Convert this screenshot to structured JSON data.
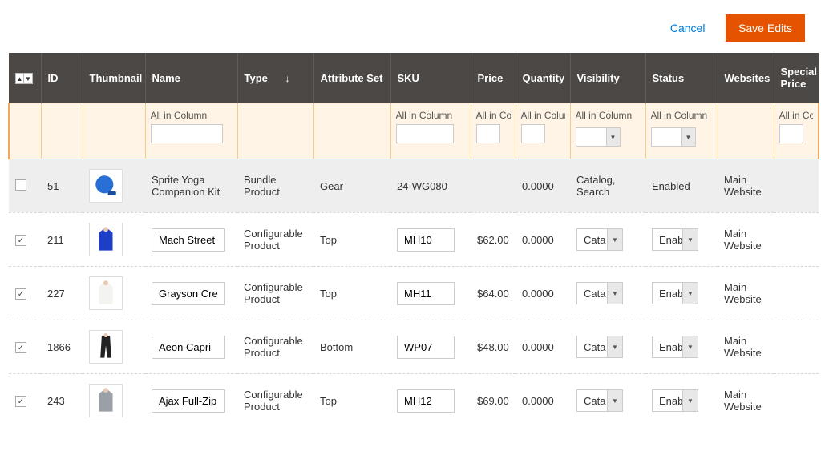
{
  "actions": {
    "cancel": "Cancel",
    "save": "Save Edits"
  },
  "headers": {
    "id": "ID",
    "thumbnail": "Thumbnail",
    "name": "Name",
    "type": "Type",
    "attribute_set": "Attribute Set",
    "sku": "SKU",
    "price": "Price",
    "quantity": "Quantity",
    "visibility": "Visibility",
    "status": "Status",
    "websites": "Websites",
    "special_price": "Special Price"
  },
  "filter": {
    "label": "All in Column"
  },
  "rows": [
    {
      "checked": false,
      "editable": false,
      "id": "51",
      "thumb_color": "#2a6fd6",
      "shape": "ball",
      "name": "Sprite Yoga Companion Kit",
      "type": "Bundle Product",
      "attribute_set": "Gear",
      "sku": "24-WG080",
      "price": "",
      "quantity": "0.0000",
      "visibility": "Catalog, Search",
      "status": "Enabled",
      "websites": "Main Website"
    },
    {
      "checked": true,
      "editable": true,
      "id": "211",
      "thumb_color": "#1f3ec7",
      "shape": "hoodie",
      "name": "Mach Street S",
      "type": "Configurable Product",
      "attribute_set": "Top",
      "sku": "MH10",
      "price": "$62.00",
      "quantity": "0.0000",
      "visibility": "Cata",
      "status": "Enab",
      "websites": "Main Website"
    },
    {
      "checked": true,
      "editable": true,
      "id": "227",
      "thumb_color": "#f3f3f0",
      "shape": "hoodie",
      "name": "Grayson Crev",
      "type": "Configurable Product",
      "attribute_set": "Top",
      "sku": "MH11",
      "price": "$64.00",
      "quantity": "0.0000",
      "visibility": "Cata",
      "status": "Enab",
      "websites": "Main Website"
    },
    {
      "checked": true,
      "editable": true,
      "id": "1866",
      "thumb_color": "#222",
      "shape": "pants",
      "name": "Aeon Capri",
      "type": "Configurable Product",
      "attribute_set": "Bottom",
      "sku": "WP07",
      "price": "$48.00",
      "quantity": "0.0000",
      "visibility": "Cata",
      "status": "Enab",
      "websites": "Main Website"
    },
    {
      "checked": true,
      "editable": true,
      "id": "243",
      "thumb_color": "#9aa0a6",
      "shape": "hoodie",
      "name": "Ajax Full-Zip S",
      "type": "Configurable Product",
      "attribute_set": "Top",
      "sku": "MH12",
      "price": "$69.00",
      "quantity": "0.0000",
      "visibility": "Cata",
      "status": "Enab",
      "websites": "Main Website"
    }
  ]
}
